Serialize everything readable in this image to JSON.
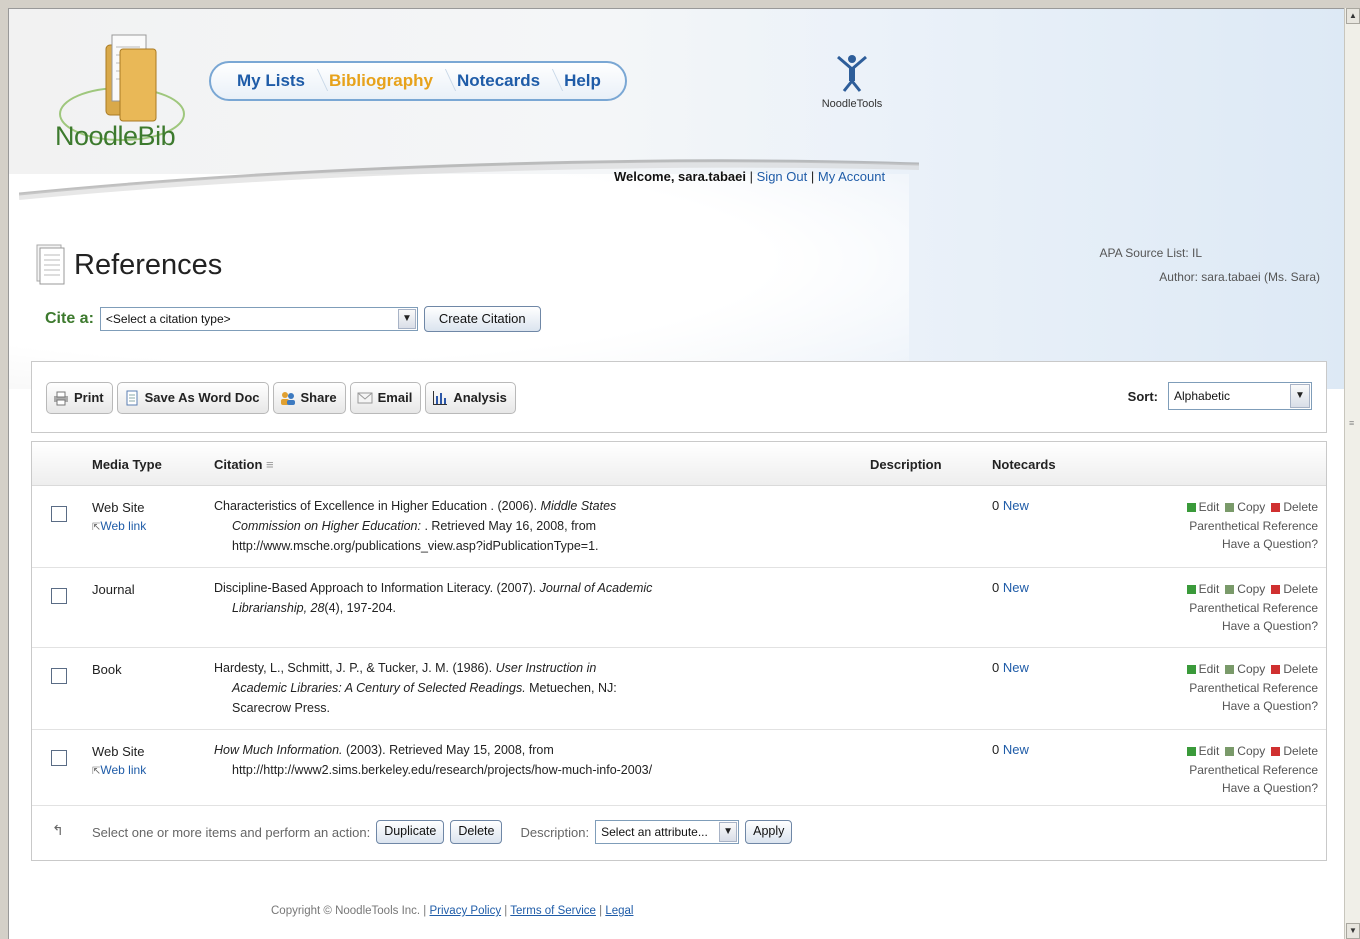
{
  "brand": {
    "app_name": "NoodleBib",
    "org_logo_label": "NoodleTools",
    "accent_green": "#3d7a2e",
    "link_blue": "#1f5ca8",
    "active_orange": "#e7a21b"
  },
  "nav": {
    "items": [
      {
        "label": "My Lists"
      },
      {
        "label": "Bibliography",
        "active": true
      },
      {
        "label": "Notecards"
      },
      {
        "label": "Help"
      }
    ]
  },
  "header": {
    "welcome_prefix": "Welcome, sara.tabaei",
    "separator": "|",
    "sign_out": "Sign Out",
    "my_account": "My Account"
  },
  "page": {
    "title": "References",
    "source_list": "APA Source List: IL",
    "author": "Author: sara.tabaei (Ms. Sara)"
  },
  "cite": {
    "label": "Cite a:",
    "select_value": "<Select a citation type>",
    "create_button": "Create Citation"
  },
  "toolbar": {
    "buttons": [
      {
        "label": "Print",
        "icon": "printer-icon"
      },
      {
        "label": "Save As Word Doc",
        "icon": "document-icon"
      },
      {
        "label": "Share",
        "icon": "users-icon"
      },
      {
        "label": "Email",
        "icon": "envelope-icon"
      },
      {
        "label": "Analysis",
        "icon": "bar-chart-icon"
      }
    ],
    "sort_label": "Sort:",
    "sort_value": "Alphabetic"
  },
  "table": {
    "headers": {
      "media": "Media Type",
      "citation": "Citation",
      "description": "Description",
      "notecards": "Notecards"
    },
    "rows": [
      {
        "media": "Web Site",
        "web_link": "Web link",
        "citation_lines": [
          {
            "text": "Characteristics of Excellence in Higher Education . (2006). ",
            "italic": "Middle States"
          },
          {
            "italic": "Commission on Higher Education:",
            "text": " . Retrieved May 16, 2008, from"
          },
          {
            "text": "http://www.msche.org/publications_view.asp?idPublicationType=1."
          }
        ],
        "notecards_count": "0",
        "notecards_new": "New"
      },
      {
        "media": "Journal",
        "web_link": "",
        "citation_lines": [
          {
            "text": "Discipline-Based Approach to Information Literacy. (2007). ",
            "italic": "Journal of Academic"
          },
          {
            "italic": "Librarianship, 28",
            "text": "(4), 197-204."
          }
        ],
        "notecards_count": "0",
        "notecards_new": "New"
      },
      {
        "media": "Book",
        "web_link": "",
        "citation_lines": [
          {
            "text": "Hardesty, L., Schmitt, J. P., & Tucker, J. M. (1986). ",
            "italic": "User Instruction in"
          },
          {
            "italic": "Academic Libraries: A Century of Selected Readings.",
            "text": " Metuechen, NJ:"
          },
          {
            "text": "Scarecrow Press."
          }
        ],
        "notecards_count": "0",
        "notecards_new": "New"
      },
      {
        "media": "Web Site",
        "web_link": "Web link",
        "citation_lines": [
          {
            "italic": "How Much Information.",
            "text": " (2003). Retrieved May 15, 2008, from"
          },
          {
            "text": "http://http://www2.sims.berkeley.edu/research/projects/how-much-info-2003/"
          }
        ],
        "notecards_count": "0",
        "notecards_new": "New"
      }
    ],
    "row_actions": {
      "edit": "Edit",
      "copy": "Copy",
      "delete": "Delete",
      "parenthetical": "Parenthetical Reference",
      "question": "Have a Question?"
    }
  },
  "bulk": {
    "prompt": "Select one or more items and perform an action:",
    "duplicate": "Duplicate",
    "delete": "Delete",
    "description_label": "Description:",
    "attribute_value": "Select an attribute...",
    "apply": "Apply"
  },
  "footer": {
    "copyright": "Copyright © NoodleTools Inc. |",
    "privacy": "Privacy Policy",
    "terms": "Terms of Service",
    "legal": "Legal",
    "sep": "|"
  }
}
